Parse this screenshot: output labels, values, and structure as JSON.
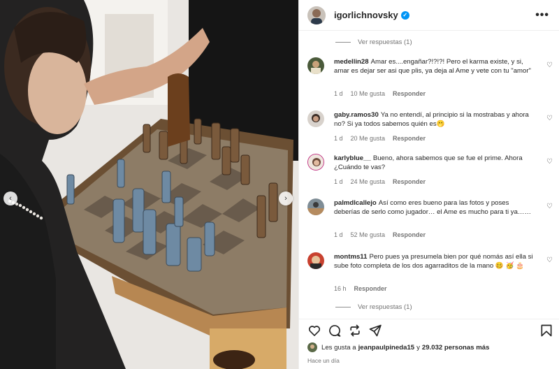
{
  "post": {
    "username": "igorlichnovsky",
    "verified_mark": "✓",
    "more_icon": "more-horizontal-icon",
    "more_label": "•••"
  },
  "photo": {
    "prev_glyph": "‹",
    "next_glyph": "›"
  },
  "replies_top": {
    "label": "Ver respuestas (1)"
  },
  "replies_bottom": {
    "label": "Ver respuestas (1)"
  },
  "comments": [
    {
      "user": "medellin28",
      "text": "Amar es....engañar?!?!?! Pero el karma existe, y si, amar es dejar ser asi que plis, ya deja al Ame y vete con tu \"amor\"",
      "time": "1 d",
      "likes": "10 Me gusta",
      "reply": "Responder"
    },
    {
      "user": "gaby.ramos30",
      "text": "Ya no entendí, al principio si la mostrabas y ahora no? Si ya todos sabemos quién es🫢",
      "time": "1 d",
      "likes": "20 Me gusta",
      "reply": "Responder"
    },
    {
      "user": "karlyblue__",
      "text": "Bueno, ahora sabemos que se fue el prime. Ahora ¿Cuándo te vas?",
      "time": "1 d",
      "likes": "24 Me gusta",
      "reply": "Responder"
    },
    {
      "user": "palmdlcallejo",
      "text": "Así como eres bueno para las fotos y poses deberías de serlo como jugador… el Ame es mucho para ti ya……",
      "time": "1 d",
      "likes": "52 Me gusta",
      "reply": "Responder"
    },
    {
      "user": "montms11",
      "text": "Pero pues ya presumela bien por qué nomás así ella si sube foto completa de los dos agarraditos de la mano 🥴 🥳 🎂",
      "time": "16 h",
      "likes": "",
      "reply": "Responder"
    }
  ],
  "likes": {
    "prefix": "Les gusta a ",
    "user": "jeanpaulpineda15",
    "middle": " y ",
    "count": "29.032 personas más"
  },
  "posted": "Hace un día",
  "icons": {
    "like": "heart-icon",
    "comment": "comment-icon",
    "share": "repost-icon",
    "send": "send-icon",
    "save": "bookmark-icon"
  },
  "colors": {
    "verified": "#0095f6",
    "muted": "#737373",
    "text": "#262626",
    "border": "#efefef"
  }
}
